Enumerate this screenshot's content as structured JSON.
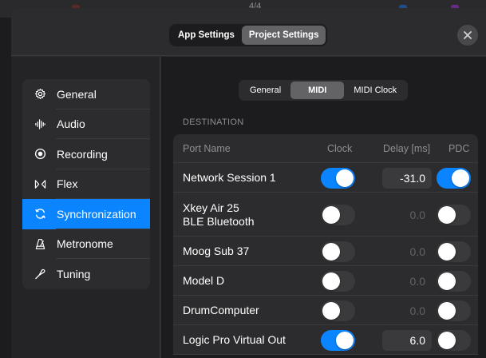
{
  "background": {
    "time_signature": "4/4"
  },
  "header": {
    "tabs": [
      {
        "label": "App Settings",
        "active": false
      },
      {
        "label": "Project Settings",
        "active": true
      }
    ],
    "close_icon": "close-icon"
  },
  "sidebar": {
    "items": [
      {
        "label": "General",
        "icon": "gear-icon",
        "active": false
      },
      {
        "label": "Audio",
        "icon": "waveform-icon",
        "active": false
      },
      {
        "label": "Recording",
        "icon": "record-icon",
        "active": false
      },
      {
        "label": "Flex",
        "icon": "flex-icon",
        "active": false
      },
      {
        "label": "Synchronization",
        "icon": "sync-icon",
        "active": true
      },
      {
        "label": "Metronome",
        "icon": "metronome-icon",
        "active": false
      },
      {
        "label": "Tuning",
        "icon": "tuning-fork-icon",
        "active": false
      }
    ]
  },
  "main": {
    "subtabs": [
      {
        "label": "General",
        "active": false
      },
      {
        "label": "MIDI",
        "active": true
      },
      {
        "label": "MIDI Clock",
        "active": false
      }
    ],
    "section_label": "DESTINATION",
    "columns": {
      "port": "Port Name",
      "clock": "Clock",
      "delay": "Delay [ms]",
      "pdc": "PDC"
    },
    "rows": [
      {
        "port": "Network Session 1",
        "clock": true,
        "delay": "-31.0",
        "pdc": true
      },
      {
        "port": "Xkey Air 25\nBLE Bluetooth",
        "clock": false,
        "delay": "0.0",
        "pdc": false
      },
      {
        "port": "Moog Sub 37",
        "clock": false,
        "delay": "0.0",
        "pdc": false
      },
      {
        "port": "Model D",
        "clock": false,
        "delay": "0.0",
        "pdc": false
      },
      {
        "port": "DrumComputer",
        "clock": false,
        "delay": "0.0",
        "pdc": false
      },
      {
        "port": "Logic Pro Virtual Out",
        "clock": true,
        "delay": "6.0",
        "pdc": false
      }
    ]
  },
  "colors": {
    "accent": "#0a84ff",
    "panel": "#2c2c2e",
    "background": "#1c1c1e",
    "secondary_text": "#8e8e93"
  }
}
